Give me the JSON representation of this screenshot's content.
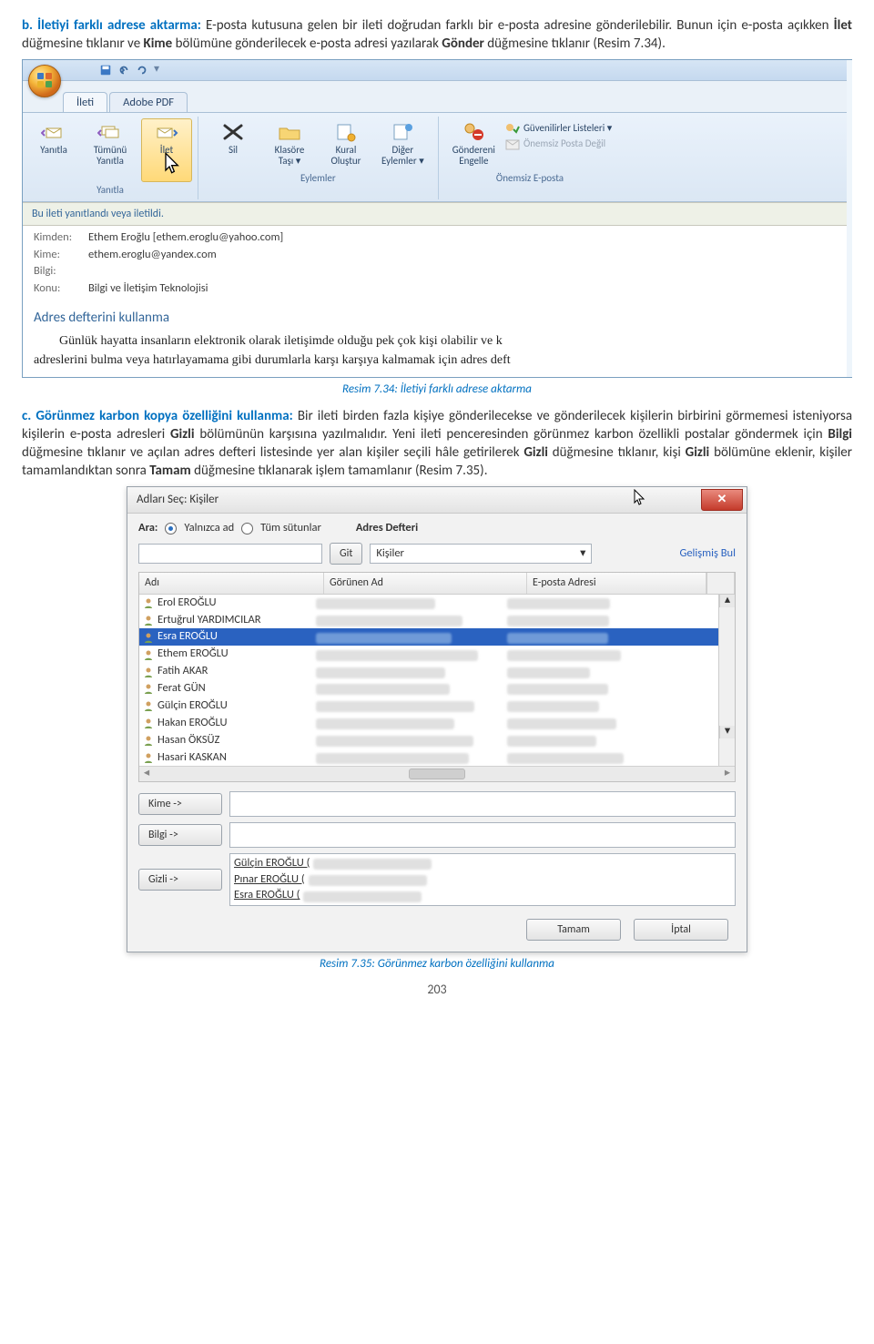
{
  "section_b": {
    "heading": "b. İletiyi farklı adrese aktarma:",
    "text1": " E-posta kutusuna gelen bir ileti doğrudan farklı bir e-posta adresine gönderilebilir. Bunun için e-posta açıkken ",
    "kw1": "İlet",
    "text2": " düğmesine tıklanır ve ",
    "kw2": "Kime",
    "text3": " bölümüne gönderilecek e-posta adresi yazılarak ",
    "kw3": "Gönder",
    "text4": " düğmesine tıklanır (Resim 7.34)."
  },
  "outlook": {
    "tab_ileti": "İleti",
    "tab_adobe": "Adobe PDF",
    "grp_yanitla": "Yanıtla",
    "btn_yanitla": "Yanıtla",
    "btn_tumunu": "Tümünü\nYanıtla",
    "btn_ilet": "İlet",
    "grp_eylemler": "Eylemler",
    "btn_sil": "Sil",
    "btn_klasore": "Klasöre\nTaşı ▾",
    "btn_kural": "Kural\nOluştur",
    "btn_diger": "Diğer\nEylemler ▾",
    "grp_onemsiz": "Önemsiz E-posta",
    "btn_engelle": "Göndereni\nEngelle",
    "lbl_guvenilir": "Güvenilirler Listeleri ▾",
    "lbl_onemsiz": "Önemsiz Posta Değil",
    "info_line": "Bu ileti yanıtlandı veya iletildi.",
    "hdr_from_l": "Kimden:",
    "hdr_from_v": "Ethem Eroğlu [ethem.eroglu@yahoo.com]",
    "hdr_to_l": "Kime:",
    "hdr_to_v": "ethem.eroglu@yandex.com",
    "hdr_cc_l": "Bilgi:",
    "hdr_subj_l": "Konu:",
    "hdr_subj_v": "Bilgi ve İletişim Teknolojisi",
    "body_title": "Adres defterini kullanma",
    "body_l1": "Günlük hayatta insanların elektronik olarak iletişimde olduğu pek çok kişi olabilir ve k",
    "body_l2": "adreslerini bulma veya hatırlayamama gibi durumlarla karşı karşıya kalmamak için adres deft"
  },
  "caption1": "Resim 7.34: İletiyi farklı adrese aktarma",
  "section_c": {
    "heading": "c. Görünmez karbon kopya özelliğini kullanma:",
    "text1": " Bir ileti birden fazla kişiye gönderilecekse ve gönderilecek kişilerin birbirini görmemesi isteniyorsa kişilerin e-posta adresleri ",
    "kw_gizli": "Gizli",
    "text2": " bölümünün karşısına yazılmalıdır. Yeni ileti penceresinden görünmez karbon özellikli postalar göndermek için ",
    "kw_bilgi": "Bilgi",
    "text3": " düğmesine tıklanır ve açılan adres defteri listesinde yer alan kişiler seçili hâle getirilerek ",
    "text4": " düğmesine tıklanır, kişi ",
    "text5": " bölümüne eklenir, kişiler tamamlandıktan sonra ",
    "kw_tamam": "Tamam",
    "text6": " düğmesine tıklanarak işlem tamamlanır (Resim 7.35)."
  },
  "dialog": {
    "title": "Adları Seç: Kişiler",
    "ara": "Ara:",
    "yalnizca": "Yalnızca ad",
    "tum": "Tüm sütunlar",
    "defter": "Adres Defteri",
    "git": "Git",
    "kisiler": "Kişiler",
    "gelismis": "Gelişmiş Bul",
    "col_ad": "Adı",
    "col_gorunen": "Görünen Ad",
    "col_eposta": "E-posta Adresi",
    "rows": [
      "Erol EROĞLU",
      "Ertuğrul YARDIMCILAR",
      "Esra EROĞLU",
      "Ethem EROĞLU",
      "Fatih AKAR",
      "Ferat GÜN",
      "Gülçin EROĞLU",
      "Hakan EROĞLU",
      "Hasan ÖKSÜZ",
      "Hasari KASKAN"
    ],
    "selected_index": 2,
    "btn_kime": "Kime ->",
    "btn_bilgi": "Bilgi ->",
    "btn_gizli": "Gizli ->",
    "gizli_names": [
      "Gülçin EROĞLU (",
      "Pınar EROĞLU (",
      "Esra EROĞLU ("
    ],
    "btn_tamam": "Tamam",
    "btn_iptal": "İptal"
  },
  "caption2": "Resim 7.35: Görünmez karbon özelliğini kullanma",
  "page": "203"
}
